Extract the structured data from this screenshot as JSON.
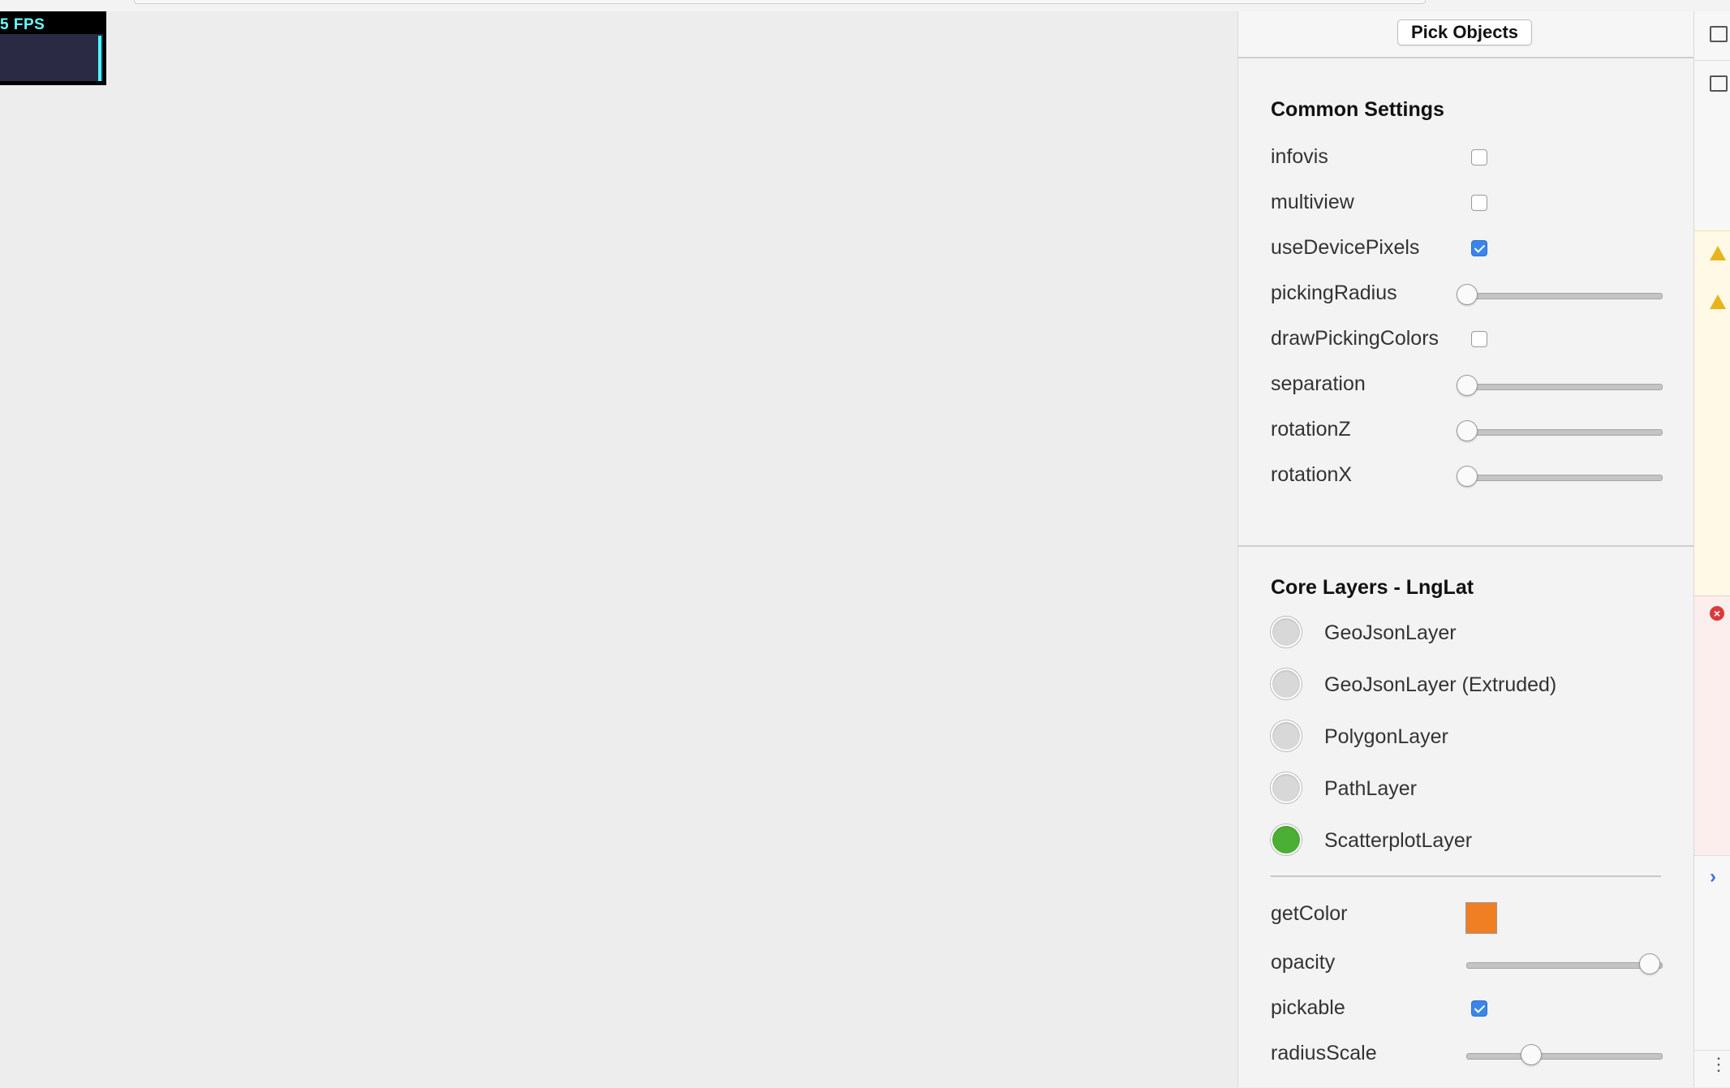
{
  "fps": {
    "label": "5 FPS"
  },
  "panel": {
    "pick_button": "Pick Objects",
    "common": {
      "title": "Common Settings",
      "rows": [
        {
          "label": "infovis",
          "kind": "checkbox",
          "checked": false
        },
        {
          "label": "multiview",
          "kind": "checkbox",
          "checked": false
        },
        {
          "label": "useDevicePixels",
          "kind": "checkbox",
          "checked": true
        },
        {
          "label": "pickingRadius",
          "kind": "slider",
          "value": 0
        },
        {
          "label": "drawPickingColors",
          "kind": "checkbox",
          "checked": false
        },
        {
          "label": "separation",
          "kind": "slider",
          "value": 0
        },
        {
          "label": "rotationZ",
          "kind": "slider",
          "value": 0
        },
        {
          "label": "rotationX",
          "kind": "slider",
          "value": 0
        }
      ]
    },
    "core": {
      "title": "Core Layers - LngLat",
      "layers": [
        {
          "label": "GeoJsonLayer",
          "selected": false
        },
        {
          "label": "GeoJsonLayer (Extruded)",
          "selected": false
        },
        {
          "label": "PolygonLayer",
          "selected": false
        },
        {
          "label": "PathLayer",
          "selected": false
        },
        {
          "label": "ScatterplotLayer",
          "selected": true
        }
      ],
      "props": {
        "getColor": {
          "label": "getColor",
          "color": "#f07f24"
        },
        "opacity": {
          "label": "opacity",
          "value": 1.0
        },
        "pickable": {
          "label": "pickable",
          "checked": true
        },
        "radiusScale": {
          "label": "radiusScale",
          "value": 0.33
        }
      }
    }
  },
  "rail": {
    "icons": [
      "inspect-icon",
      "panel-play-icon",
      "warning-icon",
      "warning-icon",
      "error-icon",
      "chevron-right-icon",
      "more-icon"
    ]
  }
}
